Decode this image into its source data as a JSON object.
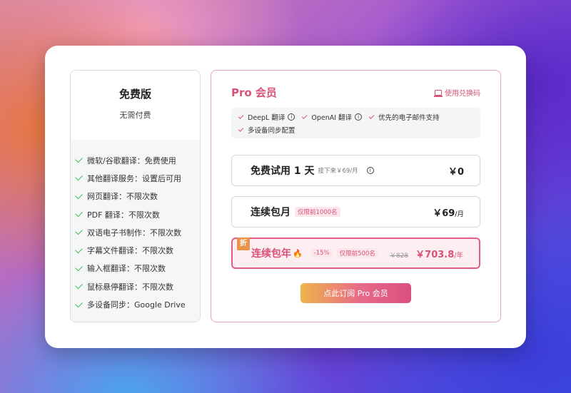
{
  "free": {
    "title": "免费版",
    "subtitle": "无需付费",
    "features": [
      "微软/谷歌翻译：免费使用",
      "其他翻译服务：设置后可用",
      "网页翻译：不限次数",
      "PDF 翻译：不限次数",
      "双语电子书制作：不限次数",
      "字幕文件翻译：不限次数",
      "输入框翻译：不限次数",
      "鼠标悬停翻译：不限次数",
      "多设备同步：Google Drive"
    ]
  },
  "pro": {
    "title": "Pro 会员",
    "redeem_label": "使用兑换码",
    "features": {
      "deepl": "DeepL 翻译",
      "openai": "OpenAI 翻译",
      "email": "优先的电子邮件支持",
      "sync": "多设备同步配置"
    },
    "info_glyph": "i",
    "plans": {
      "trial": {
        "name": "免费试用 1 天",
        "note": "接下来￥69/月",
        "price": "￥0"
      },
      "monthly": {
        "name": "连续包月",
        "badge": "仅限前1000名",
        "price": "￥69",
        "unit": "/月"
      },
      "yearly": {
        "corner": "折",
        "name": "连续包年",
        "flame": "🔥",
        "discount": "-15%",
        "badge": "仅限前500名",
        "old_price": "￥828",
        "price": "￥703.8",
        "unit": "/年"
      }
    },
    "subscribe_label": "点此订阅 Pro 会员"
  },
  "colors": {
    "accent": "#d95276",
    "check_green": "#3fb94f",
    "corner": "#e9944a"
  }
}
